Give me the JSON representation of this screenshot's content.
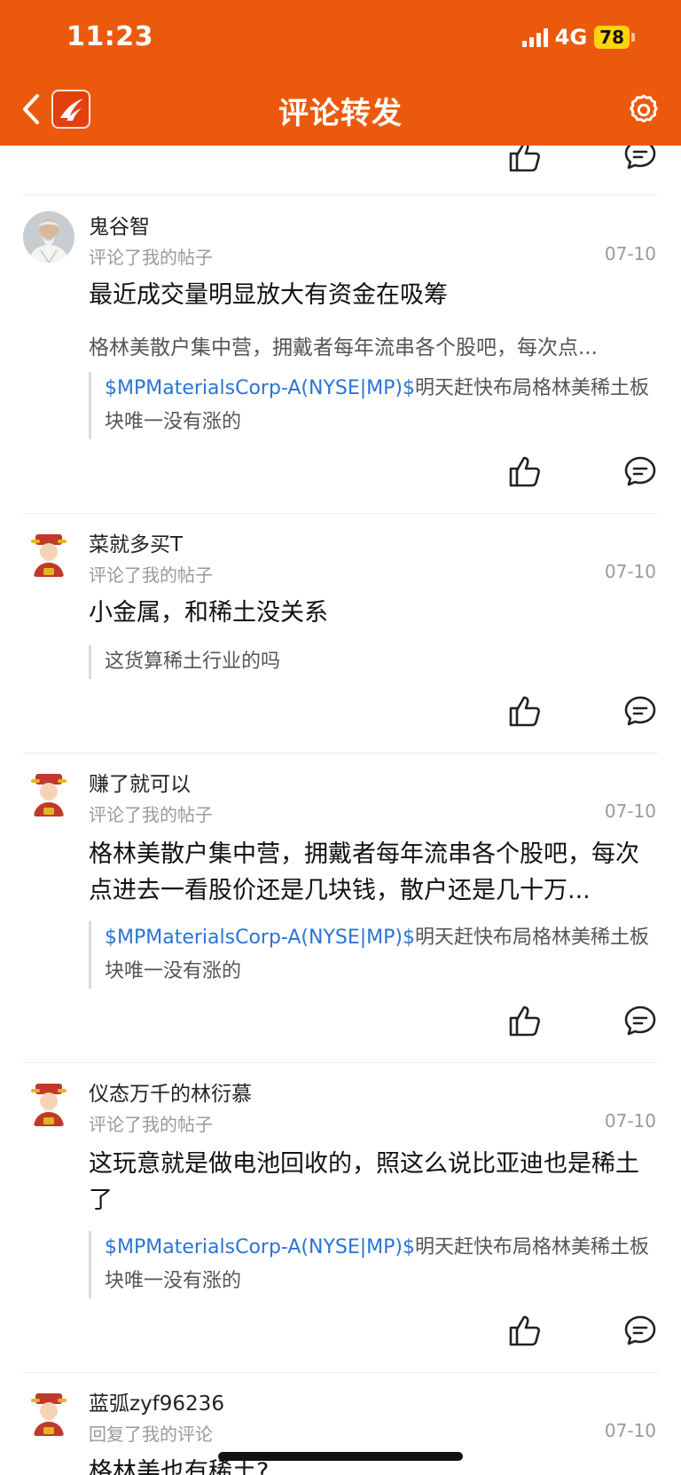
{
  "status_bar": {
    "time": "11:23",
    "network": "4G",
    "battery": "78"
  },
  "header": {
    "title": "评论转发"
  },
  "icons": {
    "back": "chevron-left-icon",
    "logo": "app-logo",
    "settings": "gear-icon",
    "like": "thumbs-up-icon",
    "comment": "comment-bubble-icon"
  },
  "colors": {
    "brand": "#eb5a0c",
    "link": "#2a74d6",
    "battery": "#ffd40a"
  },
  "posts": [
    {
      "username": "鬼谷智",
      "action": "评论了我的帖子",
      "date": "07-10",
      "title": "最近成交量明显放大有资金在吸筹",
      "excerpt": "格林美散户集中营，拥戴者每年流串各个股吧，每次点...",
      "quote_link": "$MPMaterialsCorp-A(NYSE|MP)$",
      "quote_text": "明天赶快布局格林美稀土板块唯一没有涨的"
    },
    {
      "username": "菜就多买T",
      "action": "评论了我的帖子",
      "date": "07-10",
      "title": "小金属，和稀土没关系",
      "quote_text": "这货算稀土行业的吗"
    },
    {
      "username": "赚了就可以",
      "action": "评论了我的帖子",
      "date": "07-10",
      "title": "格林美散户集中营，拥戴者每年流串各个股吧，每次点进去一看股价还是几块钱，散户还是几十万...",
      "quote_link": "$MPMaterialsCorp-A(NYSE|MP)$",
      "quote_text": "明天赶快布局格林美稀土板块唯一没有涨的"
    },
    {
      "username": "仪态万千的林衍慕",
      "action": "评论了我的帖子",
      "date": "07-10",
      "title": "这玩意就是做电池回收的，照这么说比亚迪也是稀土了",
      "quote_link": "$MPMaterialsCorp-A(NYSE|MP)$",
      "quote_text": "明天赶快布局格林美稀土板块唯一没有涨的"
    },
    {
      "username": "蓝弧zyf96236",
      "action": "回复了我的评论",
      "date": "07-10",
      "title": "格林美也有稀土?"
    }
  ]
}
